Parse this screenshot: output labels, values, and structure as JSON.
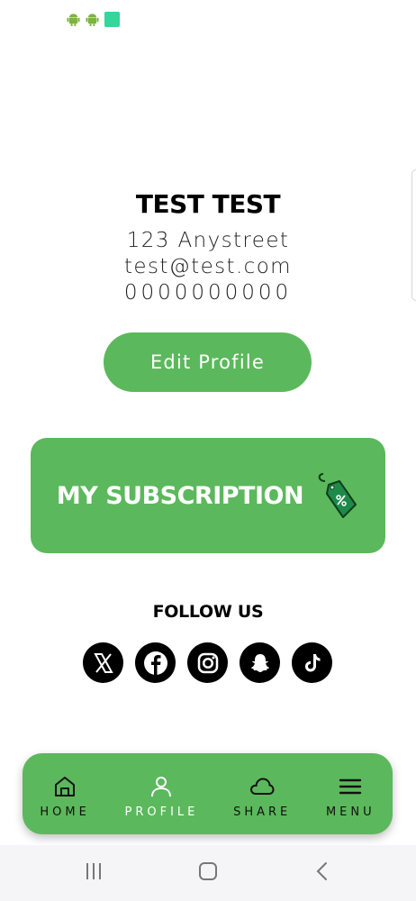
{
  "colors": {
    "accent": "#5cb85c",
    "text": "#111111",
    "background": "#ffffff",
    "system_bar": "#f5f4f7"
  },
  "status_bar": {
    "icons": [
      "android-icon",
      "android-icon",
      "notification-square-icon"
    ]
  },
  "profile": {
    "name": "TEST TEST",
    "address": "123 Anystreet",
    "email": "test@test.com",
    "phone": "0000000000"
  },
  "edit_profile": {
    "label": "Edit Profile"
  },
  "subscription": {
    "label": "MY SUBSCRIPTION",
    "icon": "price-tag-icon"
  },
  "follow": {
    "title": "FOLLOW US",
    "socials": [
      "x-icon",
      "facebook-icon",
      "instagram-icon",
      "snapchat-icon",
      "tiktok-icon"
    ]
  },
  "nav": {
    "items": [
      {
        "label": "HOME",
        "icon": "home-icon"
      },
      {
        "label": "PROFILE",
        "icon": "profile-icon",
        "active": true
      },
      {
        "label": "SHARE",
        "icon": "cloud-icon"
      },
      {
        "label": "MENU",
        "icon": "menu-icon"
      }
    ]
  },
  "system_nav": {
    "buttons": [
      "recents-icon",
      "home-square-icon",
      "back-icon"
    ]
  }
}
